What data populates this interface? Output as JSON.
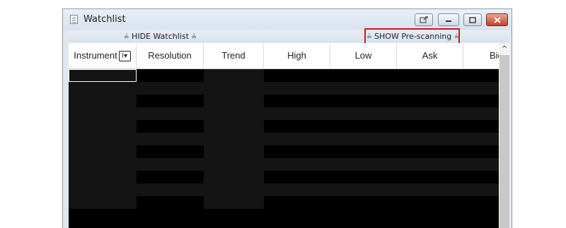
{
  "window": {
    "title": "Watchlist"
  },
  "toolbar": {
    "hide_label": "HIDE Watchlist",
    "show_label": "SHOW Pre-scanning"
  },
  "table": {
    "columns": [
      "Instrument",
      "Resolution",
      "Trend",
      "High",
      "Low",
      "Ask",
      "Bid"
    ],
    "filter_glyph": "I▾",
    "row_count": 11
  },
  "scrollbar": {
    "up_arrow": "^"
  },
  "colors": {
    "highlight": "#d01818",
    "grid_dark": "#141414",
    "grid_black": "#000000"
  }
}
